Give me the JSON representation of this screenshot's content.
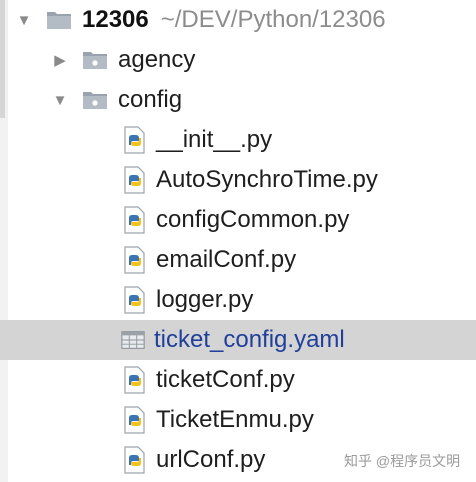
{
  "tree": {
    "root": {
      "name": "12306",
      "path": "~/DEV/Python/12306",
      "expanded": true
    },
    "folders": [
      {
        "name": "agency",
        "expanded": false
      },
      {
        "name": "config",
        "expanded": true
      }
    ],
    "files": [
      {
        "name": "__init__.py",
        "type": "python",
        "selected": false
      },
      {
        "name": "AutoSynchroTime.py",
        "type": "python",
        "selected": false
      },
      {
        "name": "configCommon.py",
        "type": "python",
        "selected": false
      },
      {
        "name": "emailConf.py",
        "type": "python",
        "selected": false
      },
      {
        "name": "logger.py",
        "type": "python",
        "selected": false
      },
      {
        "name": "ticket_config.yaml",
        "type": "yaml",
        "selected": true
      },
      {
        "name": "ticketConf.py",
        "type": "python",
        "selected": false
      },
      {
        "name": "TicketEnmu.py",
        "type": "python",
        "selected": false
      },
      {
        "name": "urlConf.py",
        "type": "python",
        "selected": false
      }
    ]
  },
  "icons": {
    "expanded_arrow": "triangle-down-icon",
    "collapsed_arrow": "triangle-right-icon",
    "folder": "folder-icon",
    "python_file": "python-file-icon",
    "yaml_file": "yaml-file-icon"
  },
  "colors": {
    "selection_bg": "#d4d4d4",
    "selected_text": "#1f3f9a",
    "path_text": "#8c8c8c",
    "python_blue": "#3b74b3",
    "python_yellow": "#f3c21b"
  },
  "watermark": "知乎 @程序员文明"
}
